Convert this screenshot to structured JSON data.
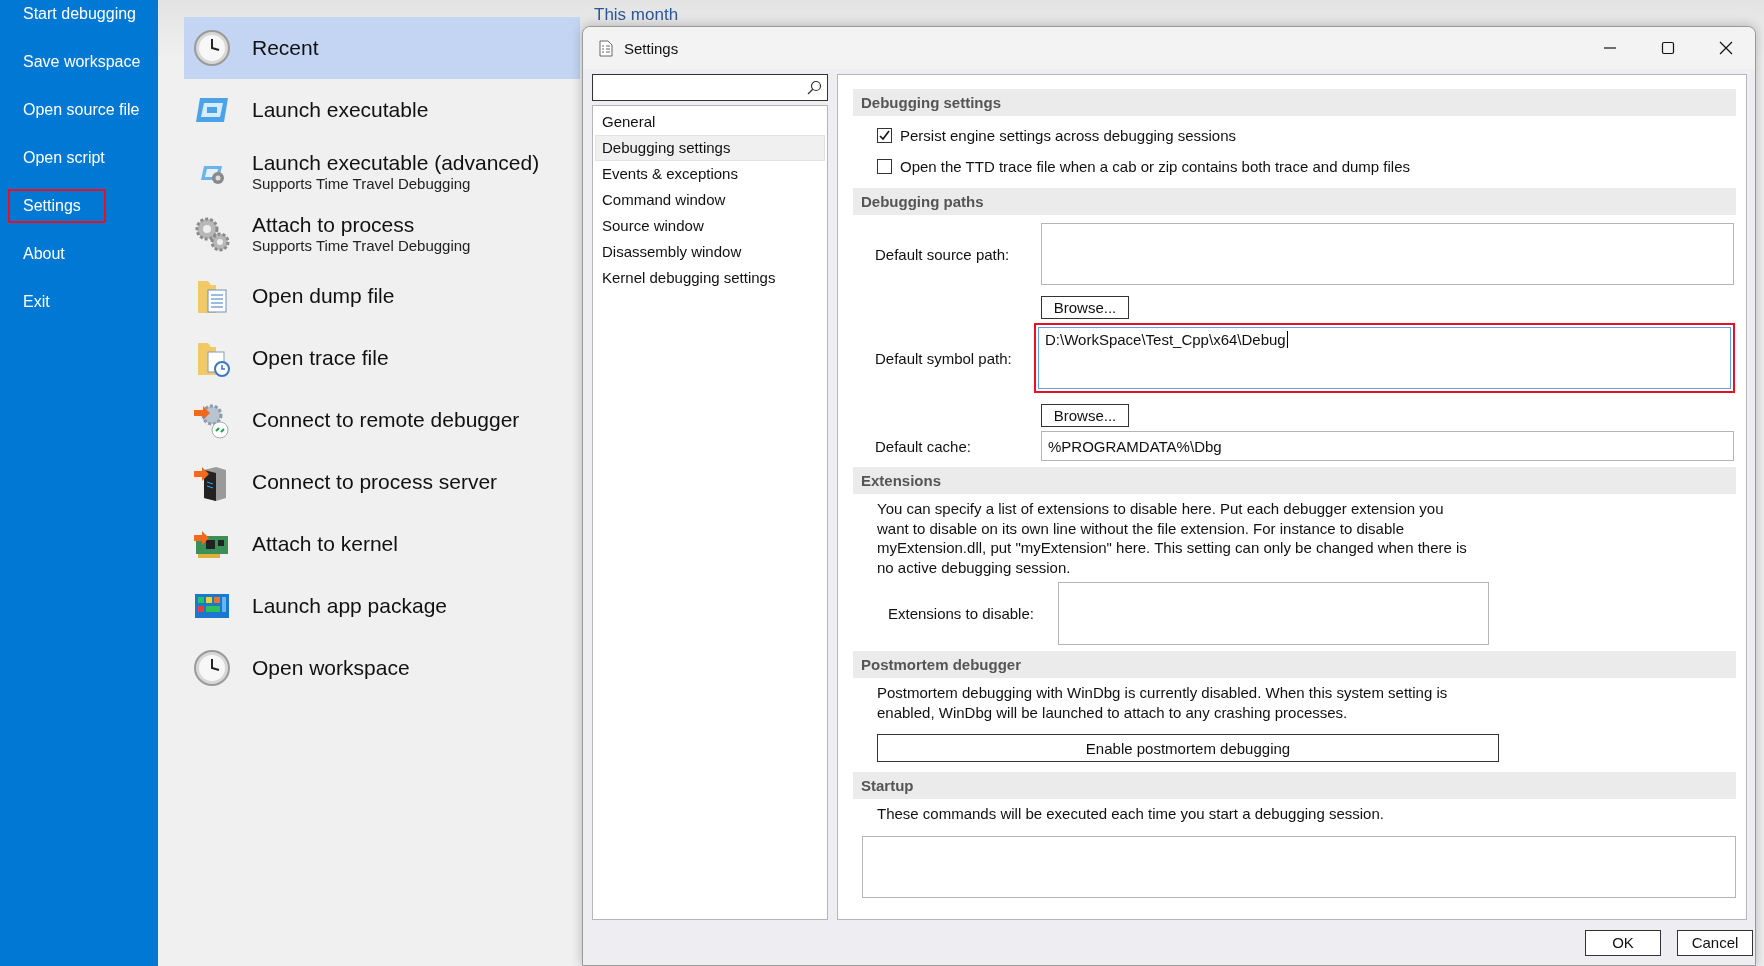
{
  "sidebar": {
    "items": [
      {
        "label": "Start debugging",
        "outlined": false
      },
      {
        "label": "Save workspace",
        "outlined": false
      },
      {
        "label": "Open source file",
        "outlined": false
      },
      {
        "label": "Open script",
        "outlined": false
      },
      {
        "label": "Settings",
        "outlined": true
      },
      {
        "label": "About",
        "outlined": false
      },
      {
        "label": "Exit",
        "outlined": false
      }
    ]
  },
  "start_list": {
    "items": [
      {
        "kind": "clock",
        "label": "Recent",
        "selected": true
      },
      {
        "kind": "window",
        "label": "Launch executable",
        "selected": false
      },
      {
        "kind": "window-gear",
        "label": "Launch executable (advanced)",
        "subtitle": "Supports Time Travel Debugging",
        "selected": false
      },
      {
        "kind": "gears",
        "label": "Attach to process",
        "subtitle": "Supports Time Travel Debugging",
        "selected": false
      },
      {
        "kind": "folder",
        "label": "Open dump file",
        "selected": false
      },
      {
        "kind": "folder-clock",
        "label": "Open trace file",
        "selected": false
      },
      {
        "kind": "remote",
        "label": "Connect to remote debugger",
        "selected": false
      },
      {
        "kind": "server",
        "label": "Connect to process server",
        "selected": false
      },
      {
        "kind": "board",
        "label": "Attach to kernel",
        "selected": false
      },
      {
        "kind": "apps",
        "label": "Launch app package",
        "selected": false
      },
      {
        "kind": "clock",
        "label": "Open workspace",
        "selected": false
      }
    ]
  },
  "recent_heading": "This month",
  "dialog": {
    "title": "Settings",
    "nav": [
      {
        "label": "General",
        "selected": false
      },
      {
        "label": "Debugging settings",
        "selected": true
      },
      {
        "label": "Events & exceptions",
        "selected": false
      },
      {
        "label": "Command window",
        "selected": false
      },
      {
        "label": "Source window",
        "selected": false
      },
      {
        "label": "Disassembly window",
        "selected": false
      },
      {
        "label": "Kernel debugging settings",
        "selected": false
      }
    ],
    "sections": [
      {
        "title": "Debugging settings",
        "rows": [
          {
            "kind": "checkbox",
            "label": "Persist engine settings across debugging sessions",
            "checked": true
          },
          {
            "kind": "checkbox",
            "label": "Open the TTD trace file when a cab or zip contains both trace and dump files",
            "checked": false
          }
        ]
      },
      {
        "title": "Debugging paths",
        "rows": [
          {
            "kind": "path",
            "label": "Default source path:",
            "button": "Browse..."
          },
          {
            "kind": "path",
            "label": "Default symbol path:",
            "value": "D:\\WorkSpace\\Test_Cpp\\x64\\Debug",
            "focused": true,
            "outlined": true,
            "button": "Browse..."
          },
          {
            "kind": "input",
            "label": "Default cache:",
            "value": "%PROGRAMDATA%\\Dbg"
          }
        ]
      },
      {
        "title": "Extensions",
        "rows": [
          {
            "kind": "text",
            "text": "You can specify a list of extensions to disable here. Put each debugger extension you want to disable on its own line without the file extension. For instance to disable myExtension.dll, put \"myExtension\" here. This setting can only be changed when there is no active debugging session."
          },
          {
            "kind": "area",
            "label": "Extensions to disable:"
          }
        ]
      },
      {
        "title": "Postmortem debugger",
        "rows": [
          {
            "kind": "text",
            "text": "Postmortem debugging with WinDbg is currently disabled. When this system setting is enabled, WinDbg will be launched to attach to any crashing processes."
          },
          {
            "kind": "button",
            "label": "Enable postmortem debugging"
          }
        ]
      },
      {
        "title": "Startup",
        "rows": [
          {
            "kind": "text",
            "text": "These commands will be executed each time you start a debugging session."
          },
          {
            "kind": "wide-area"
          }
        ]
      }
    ],
    "buttons": [
      "OK",
      "Cancel"
    ]
  }
}
